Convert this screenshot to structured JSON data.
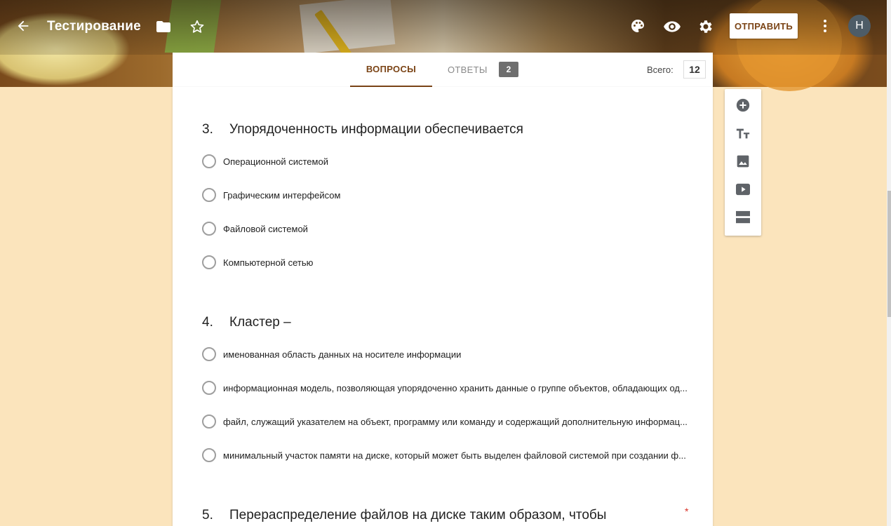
{
  "app": {
    "title": "Тестирование",
    "send_label": "ОТПРАВИТЬ",
    "avatar_letter": "Н"
  },
  "tabs": {
    "questions_label": "ВОПРОСЫ",
    "answers_label": "ОТВЕТЫ",
    "answers_count": "2",
    "total_label": "Всего:",
    "total_value": "12"
  },
  "questions": [
    {
      "number": "3.",
      "title": "Упорядоченность информации обеспечивается",
      "options": [
        "Операционной системой",
        "Графическим интерфейсом",
        "Файловой системой",
        "Компьютерной сетью"
      ]
    },
    {
      "number": "4.",
      "title": "Кластер –",
      "options": [
        "именованная область данных на носителе информации",
        "информационная модель, позволяющая упорядоченно хранить данные о группе объектов, обладающих од...",
        "файл, служащий указателем на объект, программу или команду и содержащий дополнительную информац...",
        "минимальный участок памяти на диске, который может быть выделен файловой системой при создании ф..."
      ]
    },
    {
      "number": "5.",
      "title": "Перераспределение файлов на диске таким образом, чтобы",
      "required_mark": "*",
      "options": []
    }
  ],
  "sidebar_icons": [
    "add-question-icon",
    "title-text-icon",
    "image-icon",
    "video-icon",
    "section-icon"
  ],
  "colors": {
    "accent": "#7b4416",
    "page_bg": "#fbe4bc",
    "required": "#d93025"
  }
}
